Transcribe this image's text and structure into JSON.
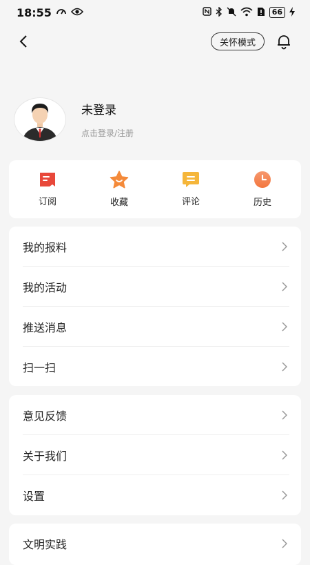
{
  "status_bar": {
    "time": "18:55",
    "battery": "66",
    "left_icons": [
      "speedometer-icon",
      "eye-icon"
    ],
    "right_icons": [
      "nfc-icon",
      "bluetooth-icon",
      "mute-icon",
      "wifi-icon",
      "sim-alert-icon",
      "battery-icon",
      "charging-icon"
    ]
  },
  "header": {
    "care_mode_label": "关怀模式"
  },
  "profile": {
    "name": "未登录",
    "subtitle": "点击登录/注册"
  },
  "quick_actions": [
    {
      "label": "订阅",
      "icon": "subscribe-icon",
      "color": "#e8483a"
    },
    {
      "label": "收藏",
      "icon": "star-icon",
      "color": "#f48a3a"
    },
    {
      "label": "评论",
      "icon": "comment-icon",
      "color": "#f5b63a"
    },
    {
      "label": "历史",
      "icon": "clock-icon",
      "color": "#f3763e"
    }
  ],
  "menu_group_1": [
    {
      "label": "我的报料"
    },
    {
      "label": "我的活动"
    },
    {
      "label": "推送消息"
    },
    {
      "label": "扫一扫"
    }
  ],
  "menu_group_2": [
    {
      "label": "意见反馈"
    },
    {
      "label": "关于我们"
    },
    {
      "label": "设置"
    }
  ],
  "menu_group_3": [
    {
      "label": "文明实践"
    }
  ]
}
